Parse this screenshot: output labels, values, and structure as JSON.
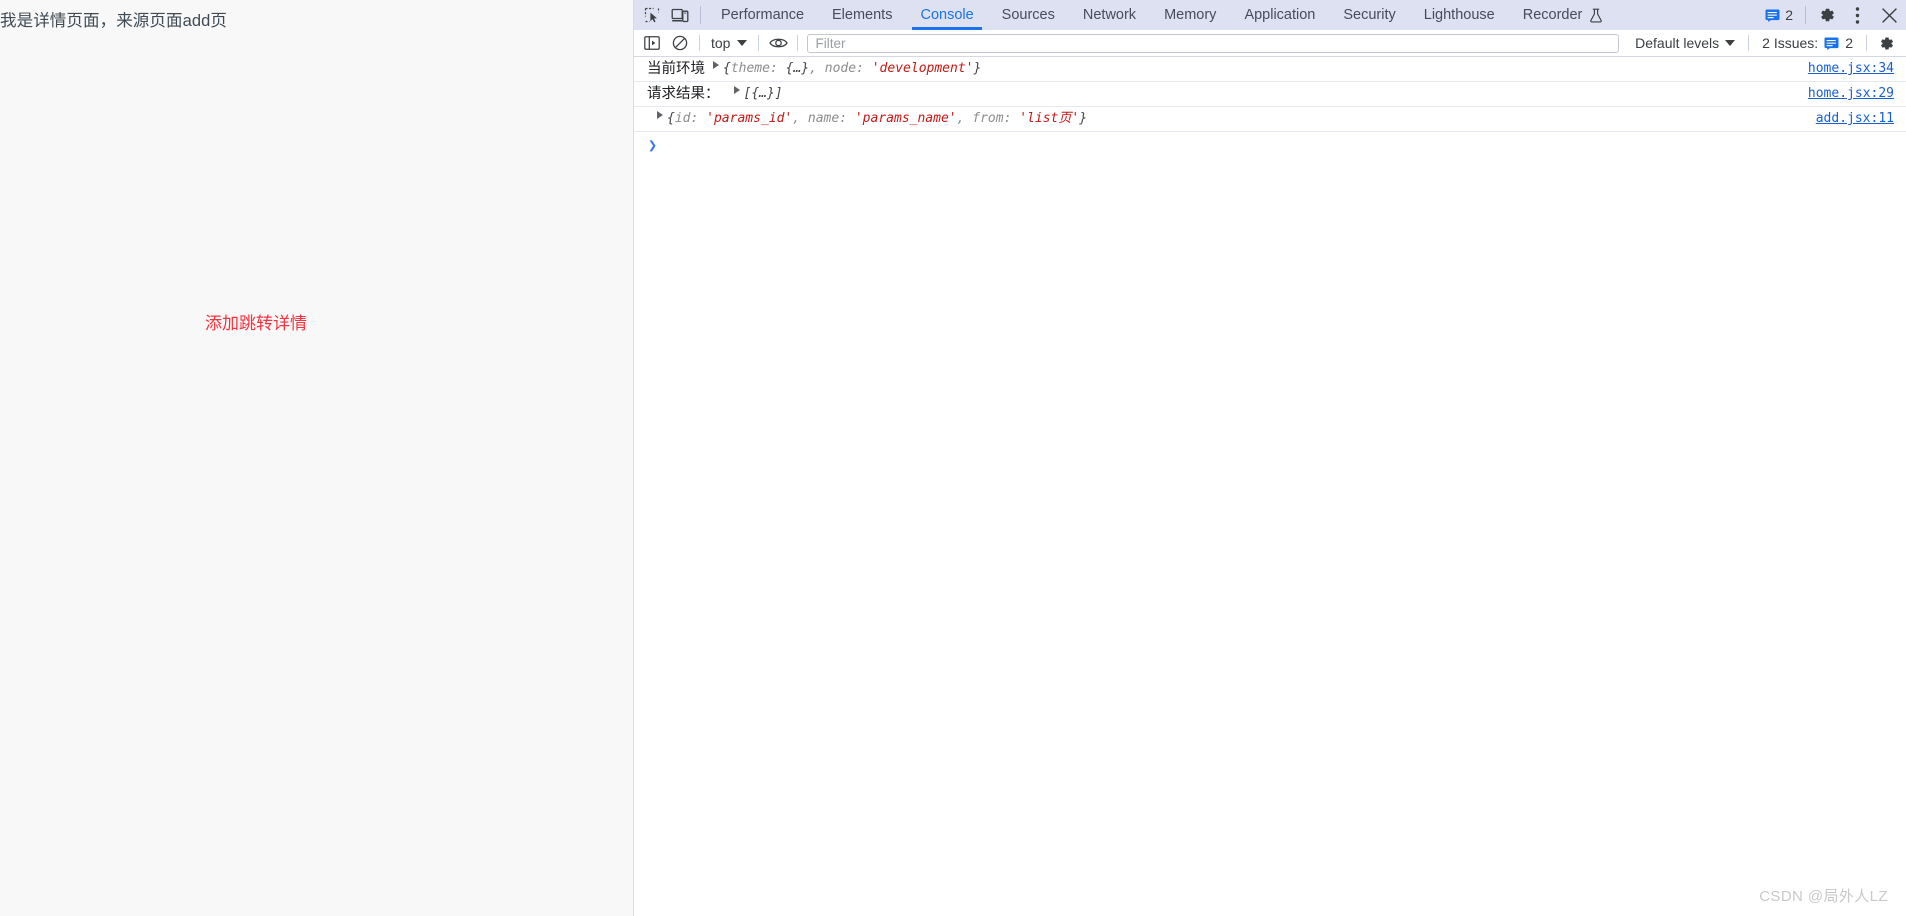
{
  "page": {
    "heading": "我是详情页面，来源页面add页",
    "link_label": "添加跳转详情",
    "link_color": "#f5333f"
  },
  "devtools": {
    "tabs": [
      {
        "label": "Performance",
        "active": false
      },
      {
        "label": "Elements",
        "active": false
      },
      {
        "label": "Console",
        "active": true
      },
      {
        "label": "Sources",
        "active": false
      },
      {
        "label": "Network",
        "active": false
      },
      {
        "label": "Memory",
        "active": false
      },
      {
        "label": "Application",
        "active": false
      },
      {
        "label": "Security",
        "active": false
      },
      {
        "label": "Lighthouse",
        "active": false
      },
      {
        "label": "Recorder",
        "active": false,
        "experimental": true
      }
    ],
    "left_icons": [
      {
        "name": "inspect-element-icon"
      },
      {
        "name": "device-toolbar-icon"
      }
    ],
    "message_badge_count": "2",
    "right_icons": [
      {
        "name": "settings-gear-icon"
      },
      {
        "name": "more-options-icon"
      },
      {
        "name": "close-devtools-icon"
      }
    ],
    "accent_color": "#1a73e8",
    "tabstrip_bg": "#dee1f1"
  },
  "console_toolbar": {
    "sidebar_toggle": "console-sidebar-icon",
    "clear_console": "clear-console-icon",
    "context": "top",
    "eye_icon": "live-expression-eye-icon",
    "filter_placeholder": "Filter",
    "filter_value": "",
    "levels_label": "Default levels",
    "issues_label": "2 Issues:",
    "issues_count": "2",
    "settings_icon": "console-settings-gear-icon"
  },
  "console_messages": [
    {
      "label": "当前环境",
      "expandable": true,
      "preview_parts": [
        {
          "text": "{",
          "kind": "brk"
        },
        {
          "text": "theme: ",
          "kind": "plain"
        },
        {
          "text": "{…}",
          "kind": "brk"
        },
        {
          "text": ", node: ",
          "kind": "plain"
        },
        {
          "text": "'development'",
          "kind": "lit"
        },
        {
          "text": "}",
          "kind": "brk"
        }
      ],
      "preview_text": "{theme: {…}, node: 'development'}",
      "source": "home.jsx:34"
    },
    {
      "label": "请求结果：",
      "expandable": true,
      "preview_parts": [
        {
          "text": "[{…}]",
          "kind": "brk"
        }
      ],
      "preview_text": "[{…}]",
      "source": "home.jsx:29"
    },
    {
      "label": "",
      "expandable": true,
      "preview_parts": [
        {
          "text": "{",
          "kind": "brk"
        },
        {
          "text": "id: ",
          "kind": "plain"
        },
        {
          "text": "'params_id'",
          "kind": "lit"
        },
        {
          "text": ", name: ",
          "kind": "plain"
        },
        {
          "text": "'params_name'",
          "kind": "lit"
        },
        {
          "text": ", from: ",
          "kind": "plain"
        },
        {
          "text": "'list页'",
          "kind": "lit"
        },
        {
          "text": "}",
          "kind": "brk"
        }
      ],
      "preview_text": "{id: 'params_id', name: 'params_name', from: 'list页'}",
      "source": "add.jsx:11"
    }
  ],
  "prompt": {
    "caret": "❯",
    "value": ""
  },
  "watermark": "CSDN @局外人LZ"
}
